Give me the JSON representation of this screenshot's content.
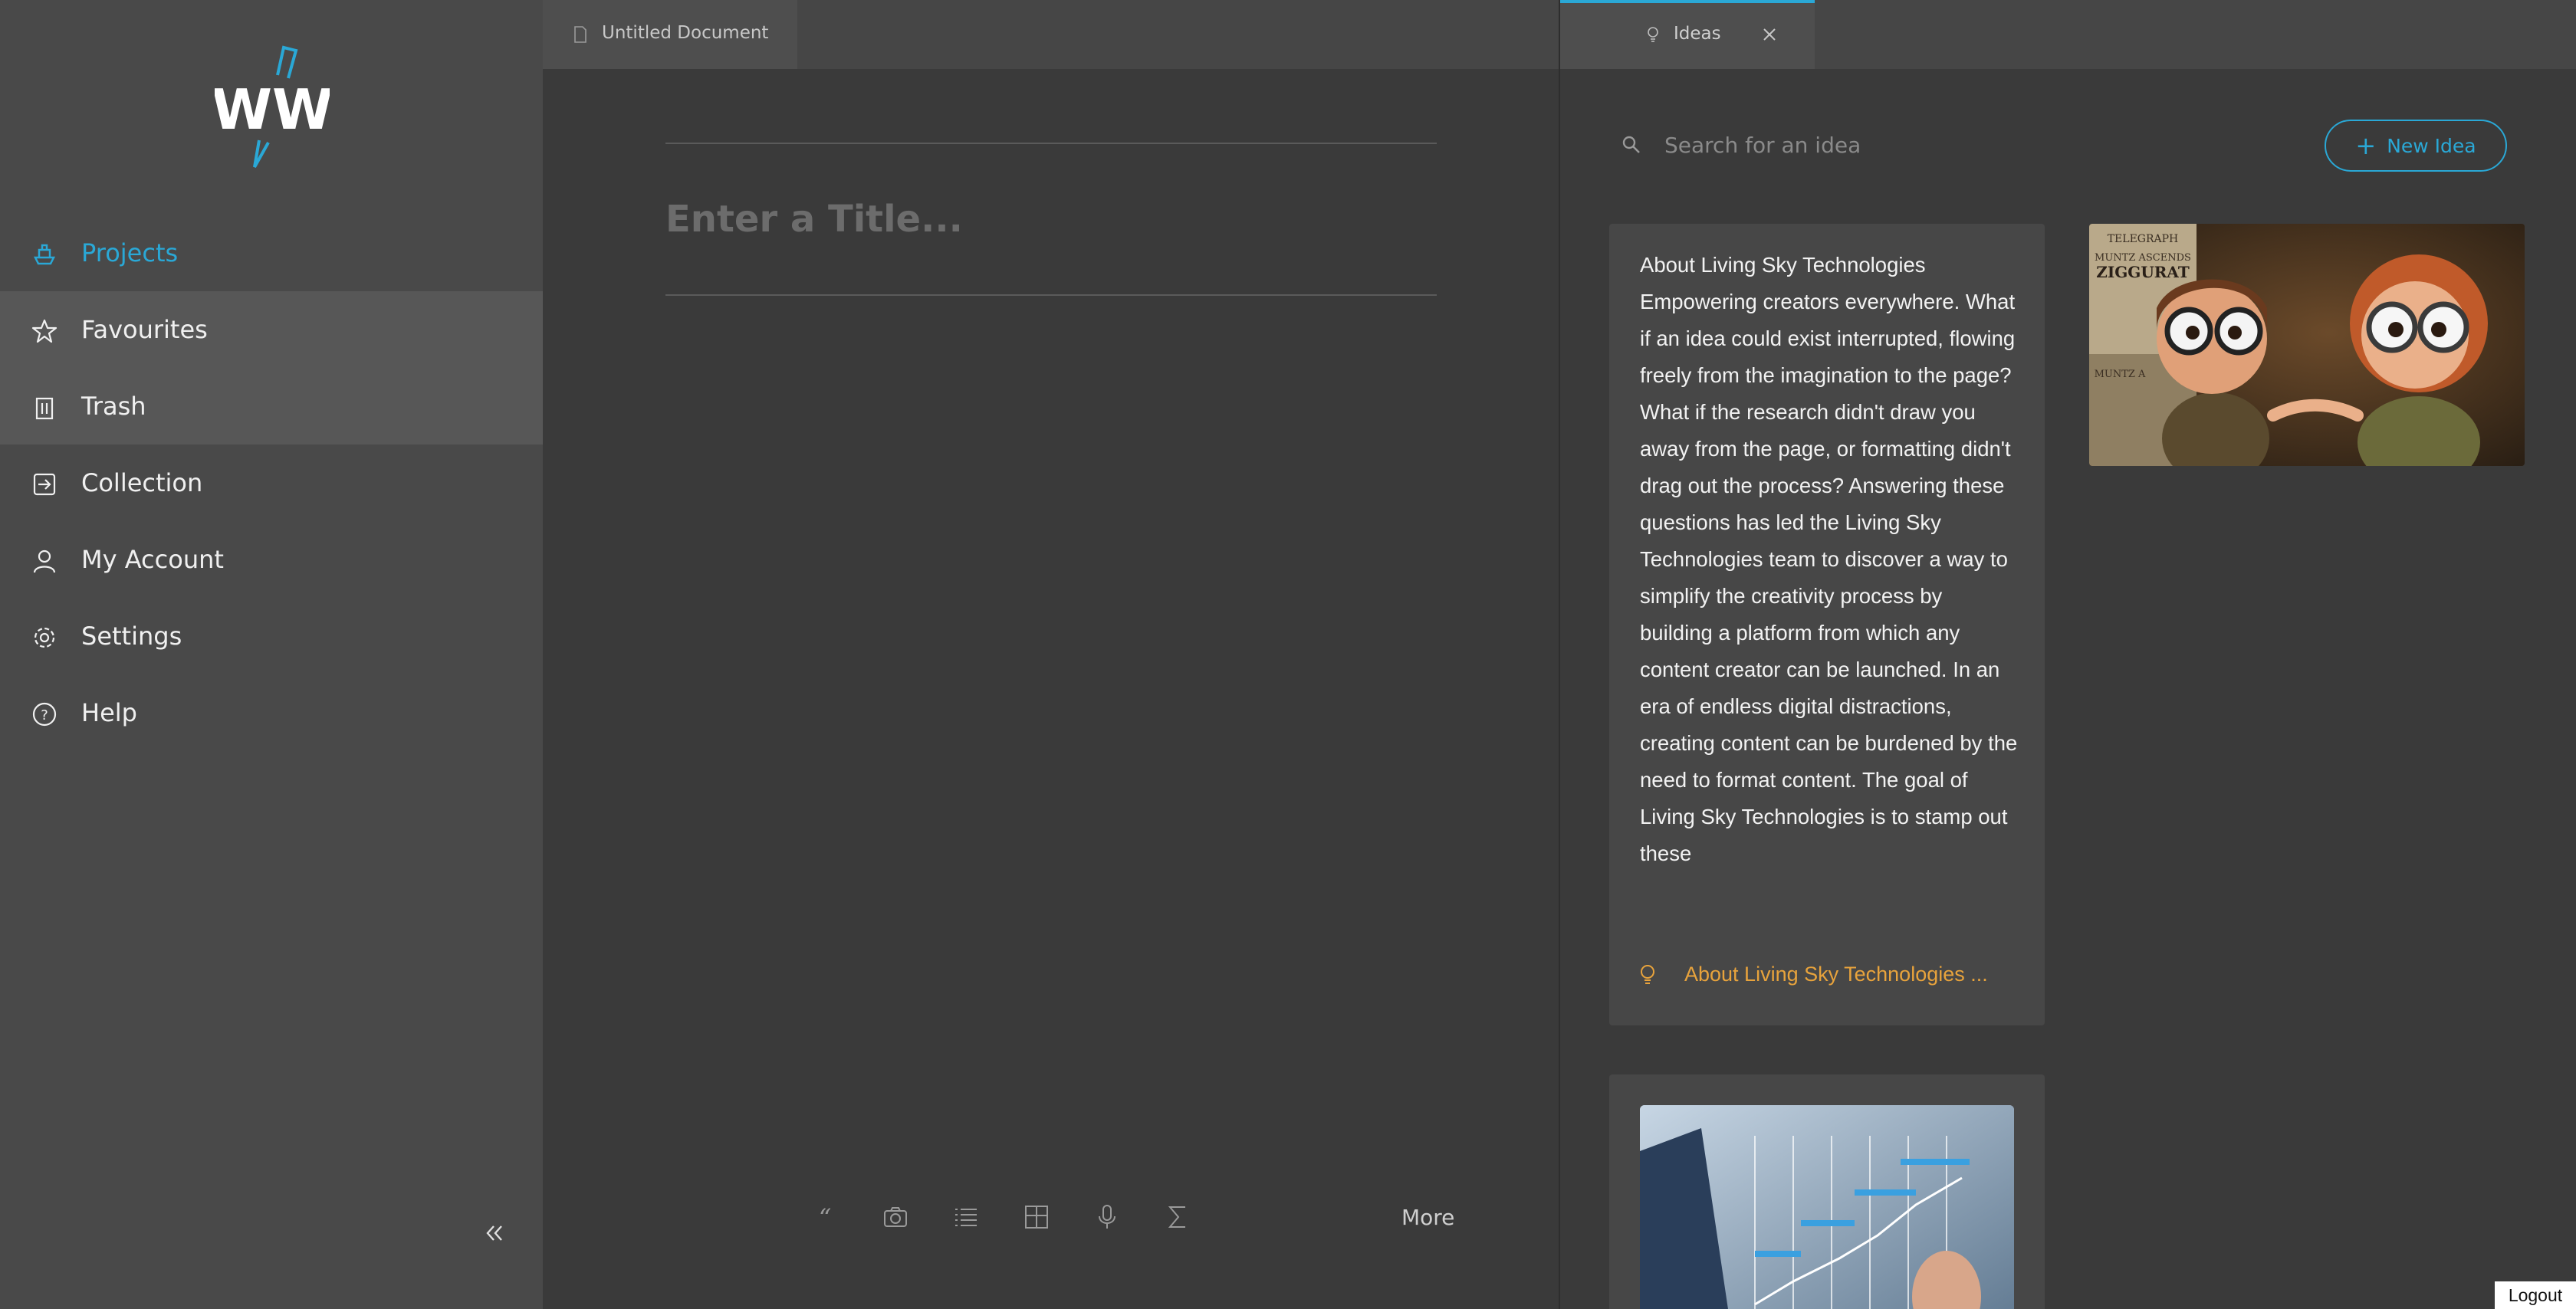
{
  "colors": {
    "accent": "#2aa8d6",
    "idea_link": "#e8a33c"
  },
  "sidebar": {
    "logo": "WW",
    "items": [
      {
        "label": "Projects",
        "icon": "boat-icon",
        "active": true
      },
      {
        "label": "Favourites",
        "icon": "star-icon"
      },
      {
        "label": "Trash",
        "icon": "trash-icon"
      },
      {
        "label": "Collection",
        "icon": "import-icon"
      },
      {
        "label": "My Account",
        "icon": "user-icon"
      },
      {
        "label": "Settings",
        "icon": "gear-icon"
      },
      {
        "label": "Help",
        "icon": "help-icon"
      }
    ],
    "collapse_icon": "double-chevron-left-icon"
  },
  "editor": {
    "tab_label": "Untitled Document",
    "title_placeholder": "Enter a Title...",
    "toolbar": {
      "tools": [
        "quote-icon",
        "camera-icon",
        "list-icon",
        "table-icon",
        "microphone-icon",
        "sigma-icon"
      ],
      "more_label": "More"
    }
  },
  "ideas": {
    "tab_label": "Ideas",
    "search_placeholder": "Search for an idea",
    "new_idea_label": "New Idea",
    "cards": [
      {
        "body": "About Living Sky Technologies Empowering creators everywhere. What if an idea could exist interrupted, flowing freely from the imagination to the page? What if the research didn't draw you away from the page, or formatting didn't drag out the process? Answering these questions has led the Living Sky Technologies team to discover a way to simplify the creativity process by building a platform from which any content creator can be launched. In an era of endless digital distractions, creating content can be burdened by the need to format content. The goal of Living Sky Technologies is to stamp out these",
        "link_label": "About Living Sky Technologies ..."
      }
    ],
    "image_card": {
      "sign_lines": [
        "TELEGRAPH",
        "MUNTZ ASCENDS",
        "ZIGGURAT",
        "MUNTZ A"
      ]
    }
  },
  "logout_label": "Logout"
}
